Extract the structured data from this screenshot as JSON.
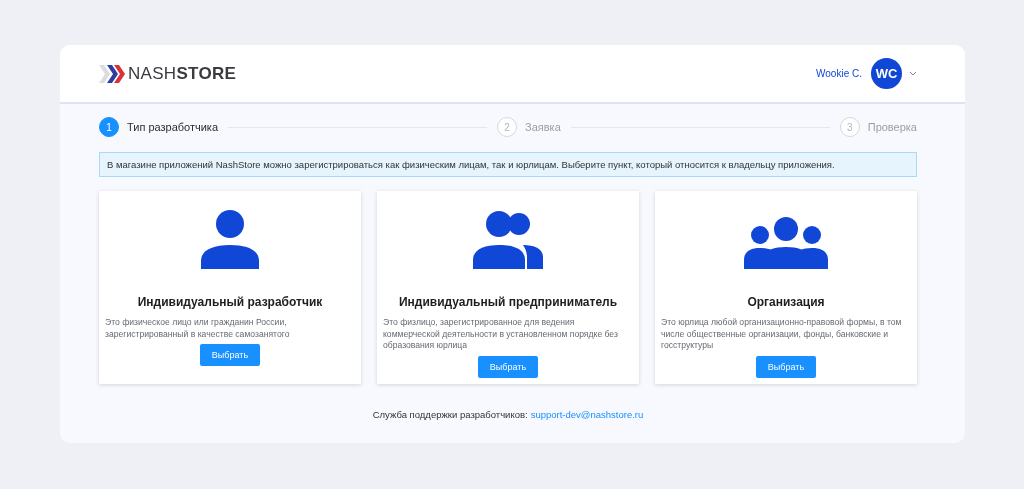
{
  "header": {
    "logo": "NASH**STORE**",
    "user_name": "Wookie C.",
    "avatar_initials": "WC"
  },
  "steps": [
    {
      "number": "1",
      "label": "Тип разработчика",
      "selected": true
    },
    {
      "number": "2",
      "label": "Заявка",
      "selected": false
    },
    {
      "number": "3",
      "label": "Проверка",
      "selected": false
    }
  ],
  "info": "В магазине приложений NashStore можно зарегистрироваться как физическим лицам, так и юрлицам. Выберите пункт, который относится к владельцу приложения.",
  "options": [
    {
      "kind": "single",
      "title": "Индивидуальный разработчик",
      "description": "Это физическое лицо или гражданин России, зарегистрированный в качестве самозанятого",
      "button": "Выбрать"
    },
    {
      "kind": "pair",
      "title": "Индивидуальный предприниматель",
      "description": "Это физлицо, зарегистрированное для ведения коммерческой деятельности в установленном порядке без образования юрлица",
      "button": "Выбрать"
    },
    {
      "kind": "group",
      "title": "Организация",
      "description": "Это юрлица любой организационно-правовой формы, в том числе общественные организации, фонды, банковские и госструктуры",
      "button": "Выбрать"
    }
  ],
  "footer": {
    "text": "Служба поддержки разработчиков:",
    "email": "support-dev@nashstore.ru"
  }
}
